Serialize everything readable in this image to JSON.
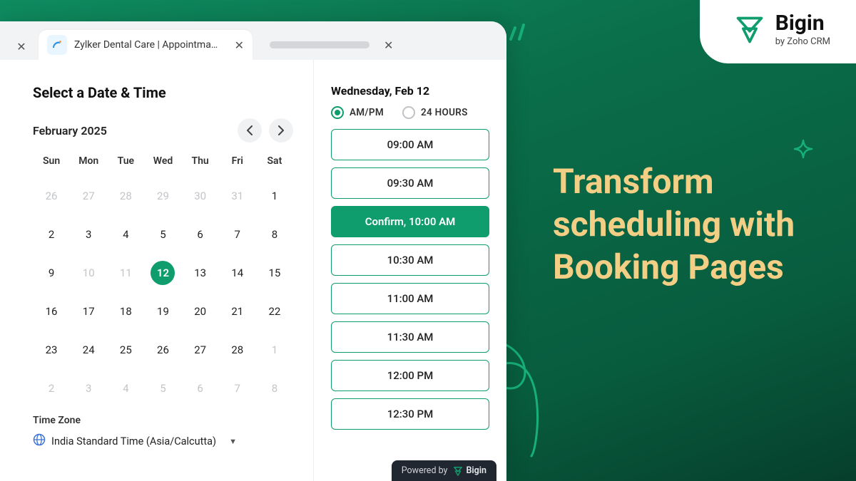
{
  "brand": {
    "name": "Bigin",
    "subtitle": "by Zoho CRM"
  },
  "hero": {
    "text": "Transform scheduling with Booking Pages"
  },
  "tabs": {
    "active_title": "Zylker Dental Care | Appointma…"
  },
  "heading": "Select a Date & Time",
  "calendar": {
    "month_label": "February 2025",
    "weekdays": [
      "Sun",
      "Mon",
      "Tue",
      "Wed",
      "Thu",
      "Fri",
      "Sat"
    ],
    "cells": [
      {
        "d": "26",
        "muted": true
      },
      {
        "d": "27",
        "muted": true
      },
      {
        "d": "28",
        "muted": true
      },
      {
        "d": "29",
        "muted": true
      },
      {
        "d": "30",
        "muted": true
      },
      {
        "d": "31",
        "muted": true
      },
      {
        "d": "1"
      },
      {
        "d": "2"
      },
      {
        "d": "3"
      },
      {
        "d": "4"
      },
      {
        "d": "5"
      },
      {
        "d": "6"
      },
      {
        "d": "7"
      },
      {
        "d": "8"
      },
      {
        "d": "9"
      },
      {
        "d": "10",
        "muted": true
      },
      {
        "d": "11",
        "muted": true
      },
      {
        "d": "12",
        "selected": true
      },
      {
        "d": "13"
      },
      {
        "d": "14"
      },
      {
        "d": "15"
      },
      {
        "d": "16"
      },
      {
        "d": "17"
      },
      {
        "d": "18"
      },
      {
        "d": "19"
      },
      {
        "d": "20"
      },
      {
        "d": "21"
      },
      {
        "d": "22"
      },
      {
        "d": "23"
      },
      {
        "d": "24"
      },
      {
        "d": "25"
      },
      {
        "d": "26"
      },
      {
        "d": "27"
      },
      {
        "d": "28"
      },
      {
        "d": "1",
        "muted": true
      },
      {
        "d": "2",
        "muted": true
      },
      {
        "d": "3",
        "muted": true
      },
      {
        "d": "4",
        "muted": true
      },
      {
        "d": "5",
        "muted": true
      },
      {
        "d": "6",
        "muted": true
      },
      {
        "d": "7",
        "muted": true
      },
      {
        "d": "8",
        "muted": true
      }
    ]
  },
  "timezone": {
    "label": "Time Zone",
    "value": "India Standard Time (Asia/Calcutta)"
  },
  "slots": {
    "date_label": "Wednesday,  Feb 12",
    "format_ampm": "AM/PM",
    "format_24h": "24 HOURS",
    "items": [
      {
        "label": "09:00 AM"
      },
      {
        "label": "09:30 AM"
      },
      {
        "label": "Confirm, 10:00 AM",
        "confirm": true
      },
      {
        "label": "10:30 AM"
      },
      {
        "label": "11:00 AM"
      },
      {
        "label": "11:30 AM"
      },
      {
        "label": "12:00 PM"
      },
      {
        "label": "12:30 PM"
      }
    ]
  },
  "footer": {
    "powered_prefix": "Powered by",
    "powered_brand": "Bigin"
  },
  "colors": {
    "accent": "#0f9d6e",
    "hero_text": "#f3ce85"
  }
}
